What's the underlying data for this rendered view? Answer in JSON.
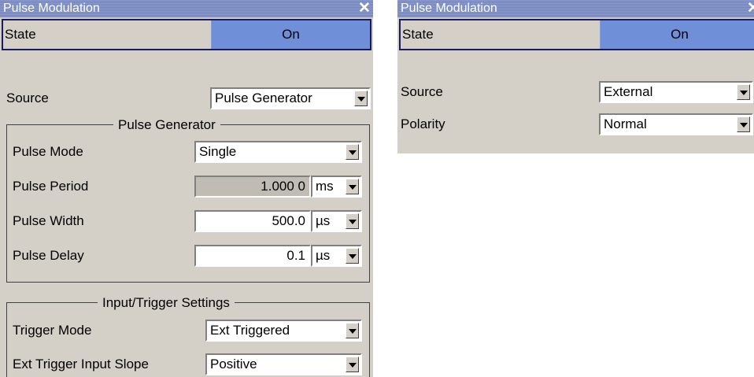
{
  "left_panel": {
    "title": "Pulse Modulation",
    "close_glyph": "✕",
    "state": {
      "label": "State",
      "value": "On"
    },
    "source": {
      "label": "Source",
      "value": "Pulse Generator"
    },
    "pulse_generator": {
      "title": "Pulse Generator",
      "pulse_mode": {
        "label": "Pulse Mode",
        "value": "Single"
      },
      "pulse_period": {
        "label": "Pulse Period",
        "value": "1.000 0",
        "unit": "ms"
      },
      "pulse_width": {
        "label": "Pulse Width",
        "value": "500.0",
        "unit": "µs"
      },
      "pulse_delay": {
        "label": "Pulse Delay",
        "value": "0.1",
        "unit": "µs"
      }
    },
    "input_trigger": {
      "title": "Input/Trigger Settings",
      "trigger_mode": {
        "label": "Trigger Mode",
        "value": "Ext Triggered"
      },
      "ext_trigger_slope": {
        "label": "Ext Trigger Input Slope",
        "value": "Positive"
      }
    }
  },
  "right_panel": {
    "title": "Pulse Modulation",
    "close_glyph": "✕",
    "state": {
      "label": "State",
      "value": "On"
    },
    "source": {
      "label": "Source",
      "value": "External"
    },
    "polarity": {
      "label": "Polarity",
      "value": "Normal"
    }
  },
  "colors": {
    "titlebar": "#7f8fc8",
    "state_on": "#6f8fd8",
    "panel_bg": "#d4d0c8"
  }
}
